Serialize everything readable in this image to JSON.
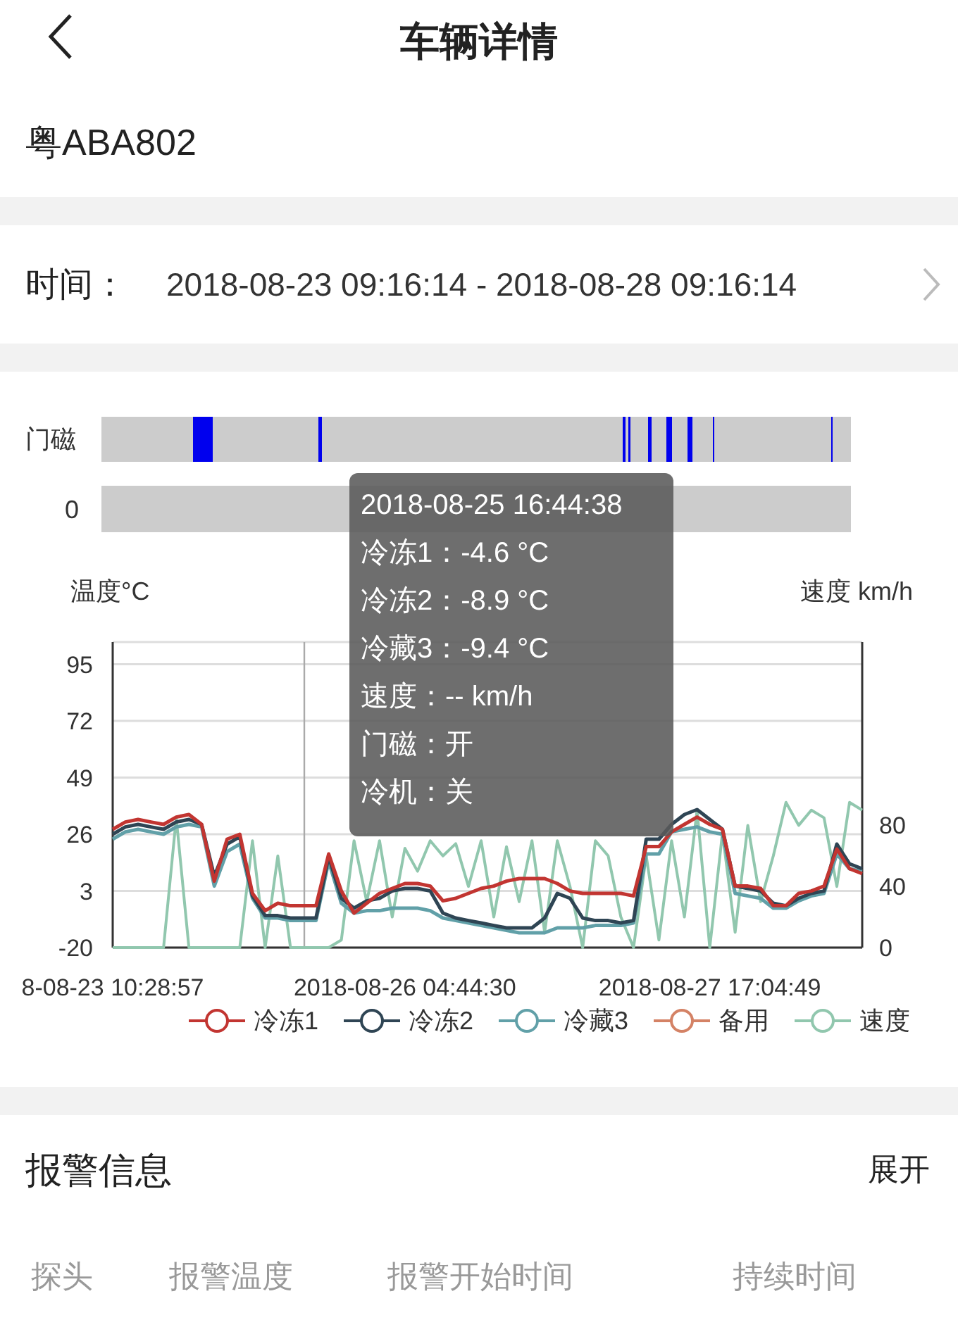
{
  "header": {
    "title": "车辆详情"
  },
  "plate": "粤ABA802",
  "time_range": {
    "label": "时间：",
    "value": "2018-08-23 09:16:14 - 2018-08-28 09:16:14"
  },
  "chart": {
    "door_label": "门磁",
    "row2_label": "0",
    "left_axis_title": "温度°C",
    "right_axis_title": "速度 km/h",
    "chart_data": {
      "type": "line",
      "categories": [
        "8-08-23 10:28:57",
        null,
        null,
        null,
        null,
        null,
        null,
        null,
        null,
        null,
        null,
        null,
        null,
        null,
        null,
        null,
        null,
        null,
        null,
        null,
        null,
        null,
        null,
        "2018-08-26 04:44:30",
        null,
        null,
        null,
        null,
        null,
        null,
        null,
        null,
        null,
        null,
        null,
        null,
        null,
        null,
        null,
        null,
        null,
        null,
        null,
        null,
        null,
        null,
        null,
        "2018-08-27 17:04:49",
        null,
        null,
        null,
        null,
        null,
        null,
        null,
        null,
        null,
        null,
        null,
        null
      ],
      "ylim": [
        -20,
        104
      ],
      "yticks": [
        -20,
        3,
        26,
        49,
        72,
        95
      ],
      "y2lim": [
        0,
        200
      ],
      "y2ticks": [
        0,
        40,
        80
      ],
      "grid": true,
      "series": [
        {
          "name": "冷冻1",
          "color": "#c23531",
          "values": [
            28,
            31,
            32,
            31,
            30,
            33,
            34,
            30,
            7,
            24,
            26,
            2,
            -5,
            -2,
            -3,
            -3,
            -3,
            18,
            3,
            -6,
            -2,
            2,
            4,
            6,
            6,
            5,
            -1,
            0,
            2,
            4,
            5,
            7,
            8,
            8,
            8,
            6,
            3,
            2,
            2,
            2,
            2,
            1,
            21,
            21,
            27,
            30,
            33,
            30,
            28,
            5,
            5,
            4,
            -3,
            -3,
            2,
            3,
            5,
            20,
            12,
            10
          ]
        },
        {
          "name": "冷冻2",
          "color": "#2f4554",
          "values": [
            26,
            29,
            30,
            29,
            28,
            31,
            32,
            30,
            9,
            22,
            25,
            1,
            -7,
            -7,
            -8,
            -8,
            -8,
            17,
            0,
            -4,
            -1,
            0,
            3,
            4,
            4,
            3,
            -6,
            -8,
            -9,
            -10,
            -11,
            -12,
            -12,
            -12,
            -8,
            2,
            0,
            -8,
            -9,
            -9,
            -10,
            -9,
            24,
            24,
            30,
            34,
            36,
            32,
            28,
            5,
            4,
            3,
            -2,
            -3,
            0,
            2,
            3,
            22,
            14,
            12
          ]
        },
        {
          "name": "冷藏3",
          "color": "#61a0a8",
          "values": [
            24,
            27,
            28,
            27,
            26,
            29,
            30,
            29,
            5,
            19,
            22,
            0,
            -8,
            -8,
            -9,
            -9,
            -9,
            15,
            -2,
            -6,
            -5,
            -5,
            -4,
            -4,
            -4,
            -5,
            -8,
            -9,
            -10,
            -11,
            -12,
            -13,
            -14,
            -14,
            -14,
            -12,
            -12,
            -12,
            -11,
            -11,
            -11,
            -10,
            18,
            18,
            27,
            28,
            29,
            27,
            26,
            2,
            1,
            0,
            -4,
            -4,
            -1,
            1,
            2,
            18,
            12,
            11
          ]
        },
        {
          "name": "备用",
          "color": "#d48265",
          "values": [
            null,
            null,
            null,
            null,
            null,
            null,
            null,
            null,
            null,
            null,
            null,
            null,
            null,
            null,
            null,
            null,
            null,
            null,
            null,
            null,
            null,
            null,
            null,
            null,
            null,
            null,
            null,
            null,
            null,
            null,
            null,
            null,
            null,
            null,
            null,
            null,
            null,
            null,
            null,
            null,
            null,
            null,
            null,
            null,
            null,
            null,
            null,
            null,
            null,
            null,
            null,
            null,
            null,
            null,
            null,
            null,
            null,
            null,
            null,
            null
          ]
        },
        {
          "name": "速度",
          "color": "#91c7ae",
          "axis": "y2",
          "values": [
            0,
            0,
            0,
            0,
            0,
            85,
            0,
            0,
            0,
            0,
            0,
            70,
            0,
            60,
            0,
            0,
            0,
            0,
            5,
            70,
            30,
            70,
            20,
            65,
            50,
            70,
            60,
            68,
            40,
            70,
            20,
            66,
            30,
            70,
            10,
            70,
            40,
            0,
            70,
            60,
            20,
            0,
            60,
            5,
            70,
            20,
            90,
            0,
            75,
            10,
            80,
            30,
            60,
            95,
            80,
            90,
            85,
            40,
            95,
            90
          ]
        }
      ]
    },
    "tooltip": {
      "title": "2018-08-25 16:44:38",
      "lines": [
        "冷冻1：-4.6 °C",
        "冷冻2：-8.9 °C",
        "冷藏3：-9.4 °C",
        "速度：-- km/h",
        "门磁：开",
        "冷机：关"
      ]
    }
  },
  "alarm": {
    "title": "报警信息",
    "toggle": "展开",
    "columns": [
      "探头",
      "报警温度",
      "报警开始时间",
      "持续时间"
    ]
  }
}
